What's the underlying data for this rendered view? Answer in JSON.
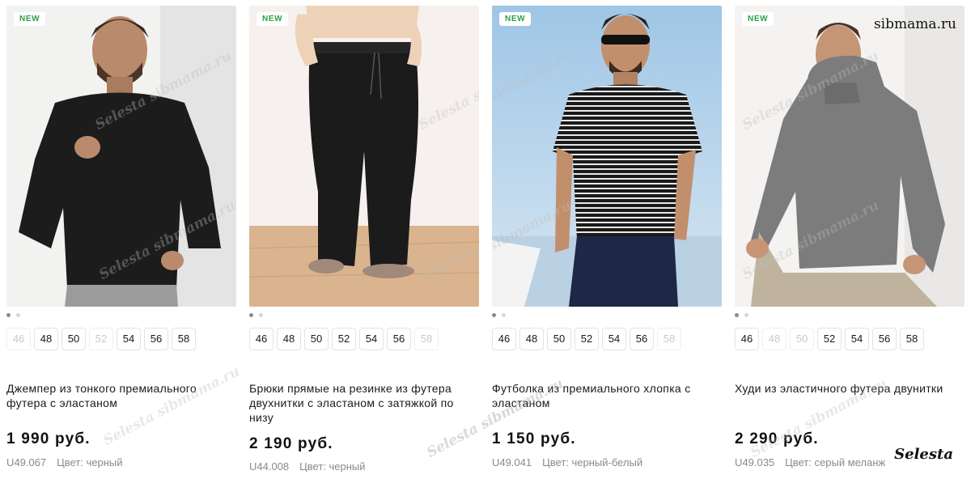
{
  "products": [
    {
      "badge": "NEW",
      "title": "Джемпер из тонкого премиального футера с эластаном",
      "price": "1 990 руб.",
      "sku": "U49.067",
      "color": "Цвет: черный",
      "sizes": [
        {
          "label": "46",
          "available": false
        },
        {
          "label": "48",
          "available": true
        },
        {
          "label": "50",
          "available": true
        },
        {
          "label": "52",
          "available": false
        },
        {
          "label": "54",
          "available": true
        },
        {
          "label": "56",
          "available": true
        },
        {
          "label": "58",
          "available": true
        }
      ]
    },
    {
      "badge": "NEW",
      "title": "Брюки прямые на резинке из футера двухнитки с эластаном с затяжкой по низу",
      "price": "2 190 руб.",
      "sku": "U44.008",
      "color": "Цвет: черный",
      "sizes": [
        {
          "label": "46",
          "available": true
        },
        {
          "label": "48",
          "available": true
        },
        {
          "label": "50",
          "available": true
        },
        {
          "label": "52",
          "available": true
        },
        {
          "label": "54",
          "available": true
        },
        {
          "label": "56",
          "available": true
        },
        {
          "label": "58",
          "available": false
        }
      ]
    },
    {
      "badge": "NEW",
      "title": "Футболка из премиального хлопка с эластаном",
      "price": "1 150 руб.",
      "sku": "U49.041",
      "color": "Цвет: черный-белый",
      "sizes": [
        {
          "label": "46",
          "available": true
        },
        {
          "label": "48",
          "available": true
        },
        {
          "label": "50",
          "available": true
        },
        {
          "label": "52",
          "available": true
        },
        {
          "label": "54",
          "available": true
        },
        {
          "label": "56",
          "available": true
        },
        {
          "label": "58",
          "available": false
        }
      ]
    },
    {
      "badge": "NEW",
      "title": "Худи из эластичного футера двунитки",
      "price": "2 290 руб.",
      "sku": "U49.035",
      "color": "Цвет: серый меланж",
      "sizes": [
        {
          "label": "46",
          "available": true
        },
        {
          "label": "48",
          "available": false
        },
        {
          "label": "50",
          "available": false
        },
        {
          "label": "52",
          "available": true
        },
        {
          "label": "54",
          "available": true
        },
        {
          "label": "56",
          "available": true
        },
        {
          "label": "58",
          "available": true
        }
      ]
    }
  ],
  "watermarks": {
    "site": "sibmama.ru",
    "brand": "Selesta",
    "overlay": "Selesta sibmama.ru"
  },
  "colors": {
    "badge_text": "#2e9e4a",
    "unavailable_size": "#c9c9c9",
    "meta_text": "#8a8a8a"
  }
}
